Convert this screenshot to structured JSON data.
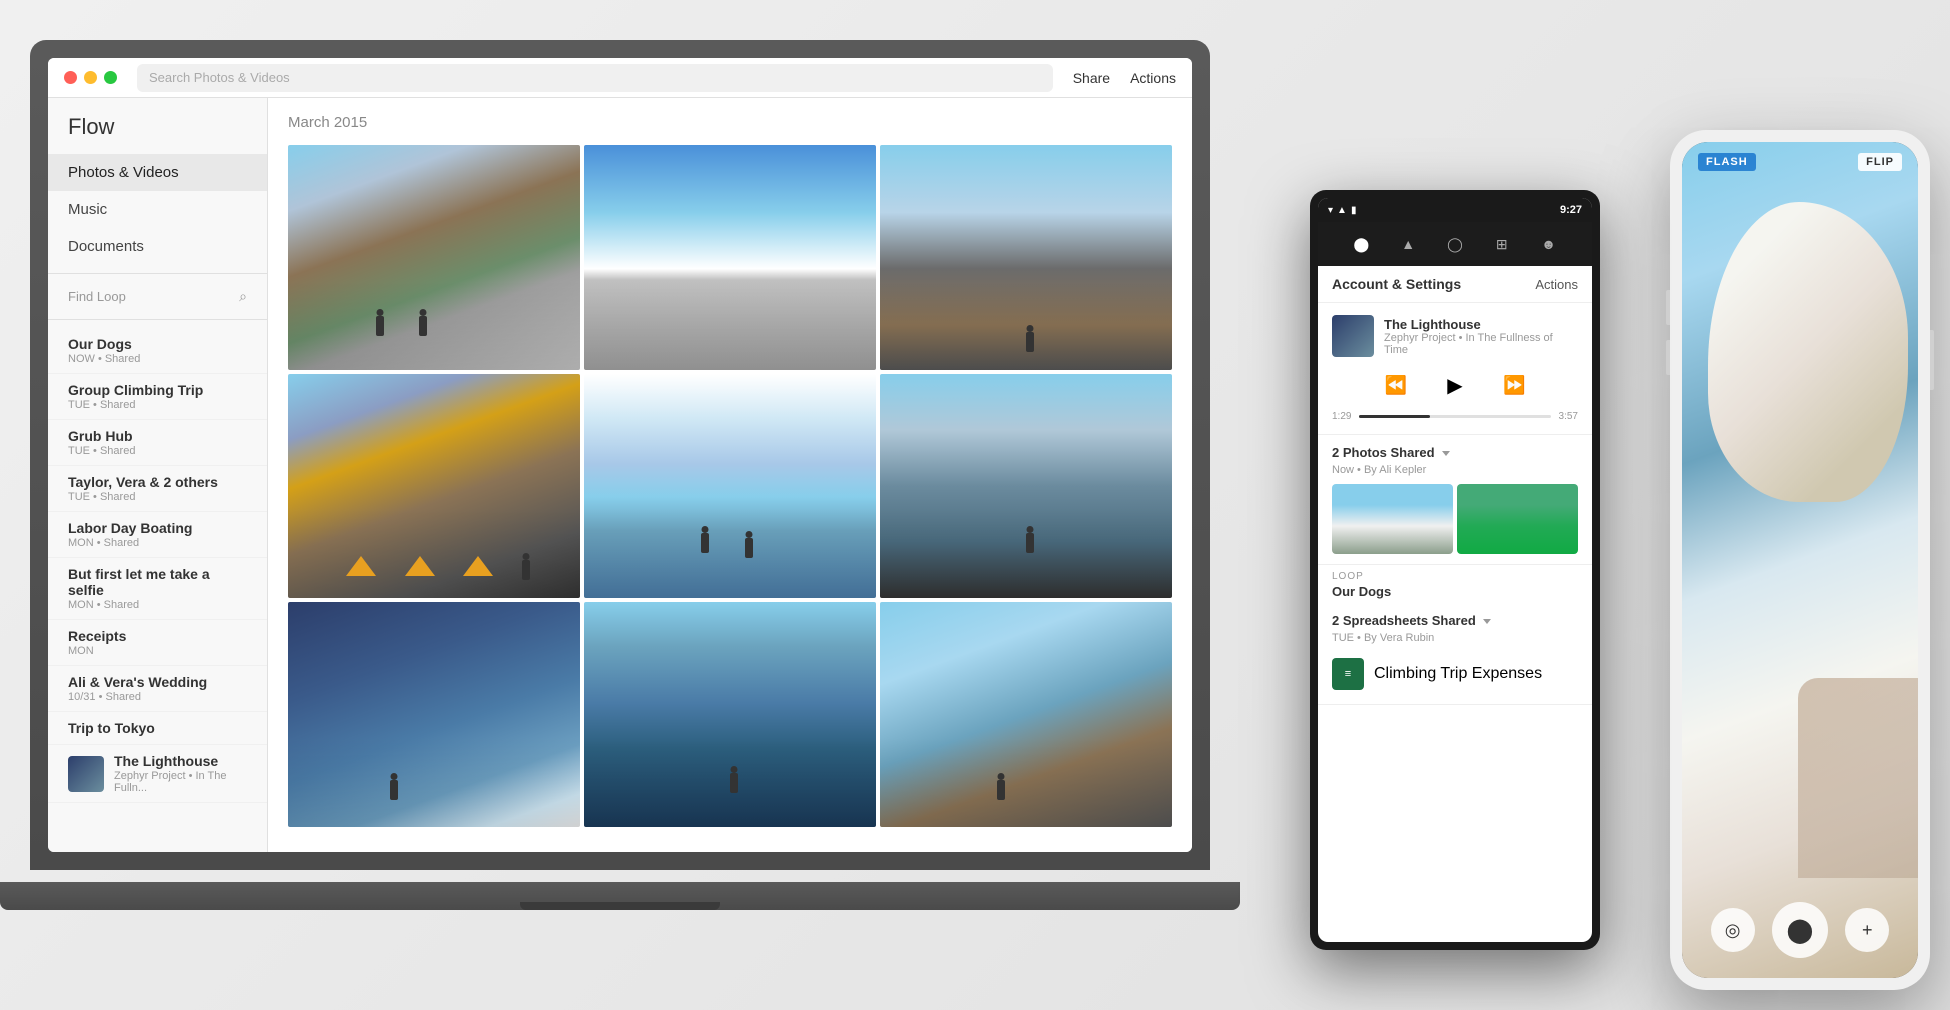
{
  "scene": {
    "background": "#e8e8e8"
  },
  "laptop": {
    "titlebar": {
      "search_placeholder": "Search Photos & Videos",
      "share_label": "Share",
      "actions_label": "Actions"
    },
    "sidebar": {
      "app_title": "Flow",
      "nav_items": [
        {
          "label": "Photos & Videos",
          "active": true
        },
        {
          "label": "Music"
        },
        {
          "label": "Documents"
        }
      ],
      "find_loop_placeholder": "Find Loop",
      "loops": [
        {
          "title": "Our Dogs",
          "meta": "NOW • Shared",
          "has_thumb": false
        },
        {
          "title": "Group Climbing Trip",
          "meta": "TUE • Shared",
          "has_thumb": false
        },
        {
          "title": "Grub Hub",
          "meta": "TUE • Shared",
          "has_thumb": false
        },
        {
          "title": "Taylor, Vera & 2 others",
          "meta": "TUE • Shared",
          "has_thumb": false
        },
        {
          "title": "Labor Day Boating",
          "meta": "MON • Shared",
          "has_thumb": false
        },
        {
          "title": "But first let me take a selfie",
          "meta": "MON • Shared",
          "has_thumb": false
        },
        {
          "title": "Receipts",
          "meta": "MON",
          "has_thumb": false
        },
        {
          "title": "Ali & Vera's Wedding",
          "meta": "10/31 • Shared",
          "has_thumb": false
        },
        {
          "title": "Trip to Tokyo",
          "meta": "",
          "has_thumb": false
        },
        {
          "title": "The Lighthouse",
          "meta": "Zephyr Project • In The Fulln...",
          "has_thumb": true
        }
      ]
    },
    "main": {
      "month_label": "March 2015",
      "photos": [
        "Mountain hikers rocky terrain",
        "Snow mountain blue sky",
        "Person standing mountain",
        "Climbers tents yellow snow",
        "Ice wall climbers",
        "Climbers snow slope",
        "Dark blue mountain valley",
        "Climber ascending",
        "Mountain snow trail"
      ]
    }
  },
  "android": {
    "status_bar": {
      "time": "9:27"
    },
    "header": {
      "title": "Account & Settings",
      "action": "Actions"
    },
    "music": {
      "track_title": "The Lighthouse",
      "track_sub": "Zephyr Project • In The Fullness of Time",
      "time_current": "1:29",
      "time_total": "3:57",
      "progress_percent": 37
    },
    "shared_photos": {
      "title": "2 Photos Shared",
      "meta": "Now • By Ali Kepler"
    },
    "loop_label": "LOOP",
    "loop_name": "Our Dogs",
    "shared_sheets": {
      "title": "2 Spreadsheets Shared",
      "meta": "TUE • By Vera Rubin",
      "sheet_name": "Climbing Trip Expenses"
    }
  },
  "iphone": {
    "logo": "FLASH",
    "flip_label": "FLIP",
    "controls": {
      "add_label": "+"
    }
  }
}
